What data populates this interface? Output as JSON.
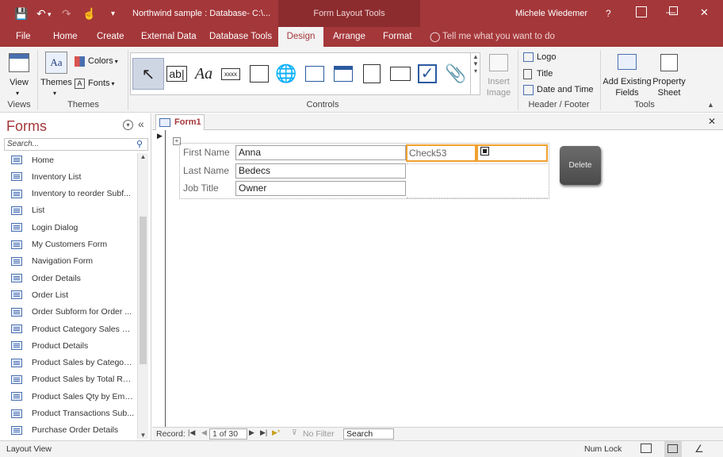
{
  "title_bar": {
    "doc_title": "Northwind sample : Database- C:\\...",
    "context_group": "Form Layout Tools",
    "user": "Michele Wiedemer",
    "help": "?",
    "minimize": "—",
    "maximize": "☐",
    "close": "✕"
  },
  "ribbon_tabs": {
    "file": "File",
    "home": "Home",
    "create": "Create",
    "external_data": "External Data",
    "database_tools": "Database Tools",
    "design": "Design",
    "arrange": "Arrange",
    "format": "Format",
    "tell_me": "Tell me what you want to do"
  },
  "ribbon": {
    "view_label": "View",
    "views_group": "Views",
    "themes_label": "Themes",
    "colors_label": "Colors",
    "fonts_label": "Fonts",
    "themes_group": "Themes",
    "controls_group": "Controls",
    "insert_image_line1": "Insert",
    "insert_image_line2": "Image",
    "logo_label": "Logo",
    "title_label": "Title",
    "date_time_label": "Date and Time",
    "header_footer_group": "Header / Footer",
    "add_fields_line1": "Add Existing",
    "add_fields_line2": "Fields",
    "property_sheet_line1": "Property",
    "property_sheet_line2": "Sheet",
    "tools_group": "Tools",
    "gallery_text": "ab|",
    "gallery_label": "Aa",
    "gallery_button": "xxxx"
  },
  "nav_pane": {
    "title": "Forms",
    "search_placeholder": "Search...",
    "items": [
      "Home",
      "Inventory List",
      "Inventory to reorder Subf...",
      "List",
      "Login Dialog",
      "My Customers Form",
      "Navigation Form",
      "Order Details",
      "Order List",
      "Order Subform for Order ...",
      "Product Category Sales by...",
      "Product Details",
      "Product Sales by Category...",
      "Product Sales by Total Rev...",
      "Product Sales Qty by Empl...",
      "Product Transactions Sub...",
      "Purchase Order Details"
    ]
  },
  "document": {
    "tab_label": "Form1",
    "close_tab": "✕",
    "fields": [
      {
        "label": "First Name",
        "value": "Anna"
      },
      {
        "label": "Last Name",
        "value": "Bedecs"
      },
      {
        "label": "Job Title",
        "value": "Owner"
      }
    ],
    "check_label": "Check53",
    "delete_button": "Delete"
  },
  "record_nav": {
    "record_label": "Record:",
    "position": "1 of 30",
    "filter": "No Filter",
    "search": "Search"
  },
  "status_bar": {
    "view": "Layout View",
    "num_lock": "Num Lock"
  },
  "colors": {
    "accent": "#a4373a",
    "selection": "#f0a030"
  }
}
